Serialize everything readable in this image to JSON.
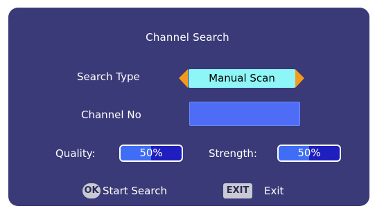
{
  "title": "Channel Search",
  "search_type": {
    "label": "Search Type",
    "value": "Manual Scan",
    "arrow_color": "#f39a1c"
  },
  "channel_no": {
    "label": "Channel No",
    "value": ""
  },
  "quality": {
    "label": "Quality:",
    "value": "50%",
    "level": 0.5
  },
  "strength": {
    "label": "Strength:",
    "value": "50%",
    "level": 0.5
  },
  "footer": {
    "ok_icon_text": "OK",
    "start_search_label": "Start Search",
    "exit_icon_text": "EXIT",
    "exit_label": "Exit"
  },
  "colors": {
    "panel": "#3a3a78",
    "selector": "#8ef6f6",
    "input": "#4e6cf6",
    "meter_fill": "#3f6df5",
    "meter_empty": "#1f1fbf"
  }
}
